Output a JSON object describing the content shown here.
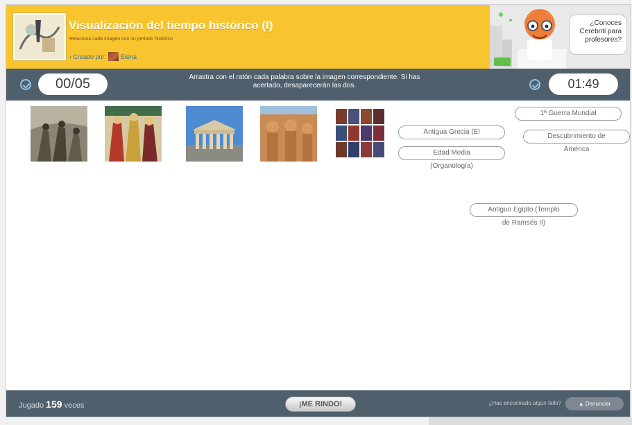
{
  "header": {
    "title": "Visualización del tiempo histórico (I)",
    "subtitle": "Relaciona cada imagen con su periodo histórico",
    "creator_prefix": "› Creado por:",
    "creator_name": "Elena",
    "colors": {
      "header_bg": "#f9c52f",
      "bar_bg": "#4f5f6c",
      "accent": "#8fc4ee"
    }
  },
  "promo": {
    "line1": "¿Conoces",
    "line2": "Cerebriti para",
    "line3": "profesores?"
  },
  "toolbar": {
    "score": "00/05",
    "timer": "01:49",
    "instruction_line1": "Arrastra con el ratón cada palabra sobre la imagen correspondiente. Si has",
    "instruction_line2": "acertado, desaparecerán las dos.",
    "score_icon": "check-circle-icon",
    "timer_icon": "check-circle-icon"
  },
  "game": {
    "images": [
      {
        "name": "soldiers-painting",
        "alt": "Soldados"
      },
      {
        "name": "medieval-illustration",
        "alt": "Ilustración medieval"
      },
      {
        "name": "parthenon-photo",
        "alt": "Partenón"
      },
      {
        "name": "ramses-temple-photo",
        "alt": "Templo de Ramsés II"
      },
      {
        "name": "natives-collage",
        "alt": "Collage"
      }
    ],
    "words": [
      {
        "chip": "Antigua Grecia (El",
        "rest": ""
      },
      {
        "chip": "Edad Media",
        "rest": "(Organología)"
      },
      {
        "chip": "1ª Guerra Mundial",
        "rest": ""
      },
      {
        "chip": "Descubrimiento de",
        "rest": "América"
      },
      {
        "chip": "Antiguo Egipto (Templo",
        "rest": "de Ramsés II)"
      }
    ]
  },
  "footer": {
    "played_prefix": "Jugado",
    "played_count": "159",
    "played_suffix": "veces",
    "give_up": "¡ME RINDO!",
    "report_question": "¿Has encontrado algún fallo?",
    "report_button": "▲ Denunciar"
  }
}
